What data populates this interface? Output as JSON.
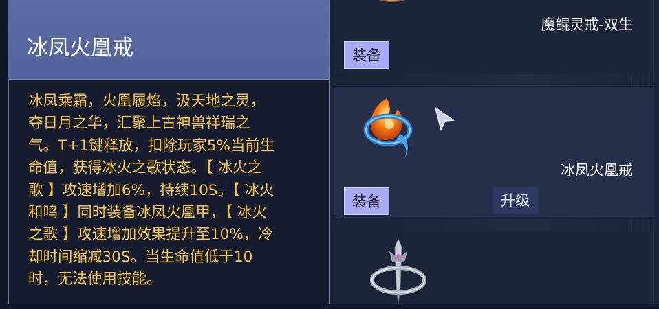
{
  "tooltip": {
    "title": "冰凤火凰戒",
    "description": "冰凤乘霜，火凰履焰，汲天地之灵，\n夺日月之华，汇聚上古神兽祥瑞之\n气。T+1键释放，扣除玩家5%当前生\n命值，获得冰火之歌状态。【 冰火之\n歌 】攻速增加6%，持续10S。【 冰火\n和鸣 】同时装备冰凤火凰甲，【 冰火\n之歌 】攻速增加效果提升至10%，冷\n却时间缩减30S。当生命值低于10\n时，无法使用技能。"
  },
  "items": [
    {
      "name": "魔鲲灵戒-双生",
      "equip_label": "装备",
      "icon": "ring-icon-bronze"
    },
    {
      "name": "冰凤火凰戒",
      "equip_label": "装备",
      "upgrade_label": "升级",
      "icon": "ring-icon-phoenix"
    },
    {
      "name": "",
      "icon": "ring-icon-silver-sword"
    }
  ],
  "colors": {
    "tooltip_header": "#55659d",
    "tooltip_text": "#f5c64a",
    "equip_button": "#a8aaf5",
    "upgrade_button": "#2e3961"
  }
}
